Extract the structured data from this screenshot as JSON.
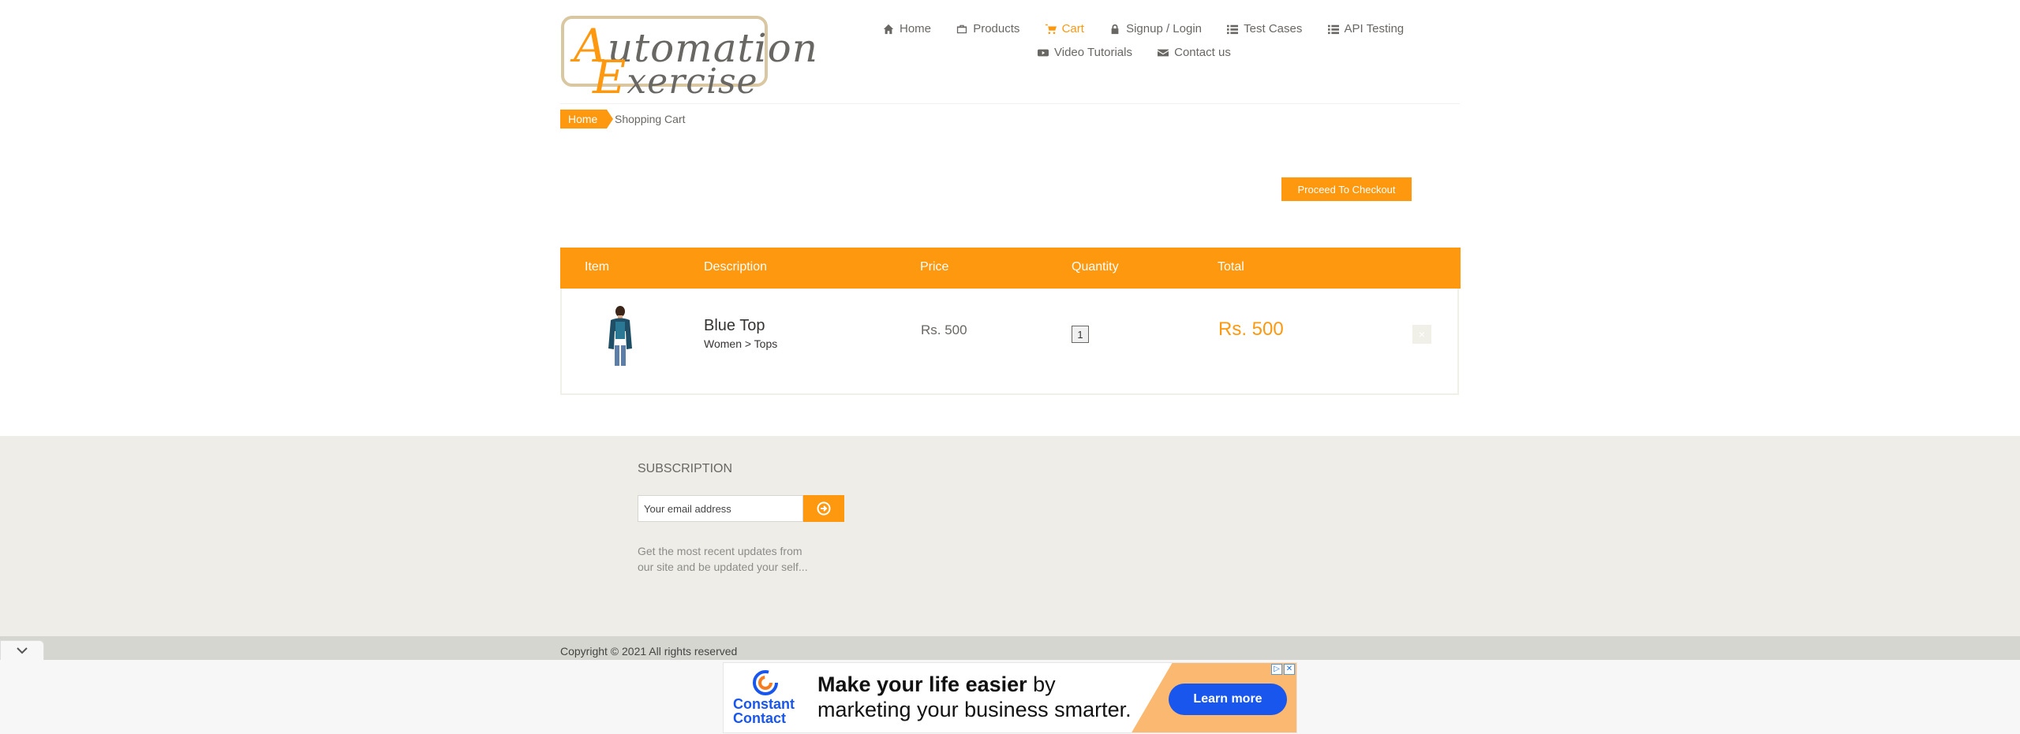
{
  "logo": {
    "line1_cap": "A",
    "line1_rest": "utomation",
    "line2_cap": "E",
    "line2_rest": "xercise"
  },
  "nav": {
    "items": [
      {
        "label": "Home",
        "icon": "home-icon"
      },
      {
        "label": "Products",
        "icon": "products-icon"
      },
      {
        "label": "Cart",
        "icon": "cart-icon",
        "active": true
      },
      {
        "label": "Signup / Login",
        "icon": "lock-icon"
      },
      {
        "label": "Test Cases",
        "icon": "list-icon"
      },
      {
        "label": "API Testing",
        "icon": "list-icon"
      },
      {
        "label": "Video Tutorials",
        "icon": "youtube-icon"
      },
      {
        "label": "Contact us",
        "icon": "envelope-icon"
      }
    ]
  },
  "breadcrumb": {
    "home": "Home",
    "current": "Shopping Cart"
  },
  "checkout": {
    "label": "Proceed To Checkout"
  },
  "cart": {
    "columns": [
      "Item",
      "Description",
      "Price",
      "Quantity",
      "Total"
    ],
    "rows": [
      {
        "name": "Blue Top",
        "category": "Women > Tops",
        "price": "Rs. 500",
        "quantity": "1",
        "total": "Rs. 500",
        "delete_symbol": "×"
      }
    ]
  },
  "footer": {
    "subscription_title": "SUBSCRIPTION",
    "email_placeholder": "Your email address",
    "note": "Get the most recent updates from our site and be updated your self...",
    "copyright": "Copyright © 2021 All rights reserved"
  },
  "ad": {
    "brand_line1": "Constant",
    "brand_line2": "Contact",
    "headline_bold": "Make your life easier",
    "headline_rest": " by",
    "headline_line2": "marketing your business smarter.",
    "cta": "Learn more",
    "choices_icon": "▷",
    "close_icon": "✕"
  },
  "colors": {
    "accent": "#fe980f",
    "footer_bg": "#eeede8",
    "ad_blue": "#1856ed"
  }
}
